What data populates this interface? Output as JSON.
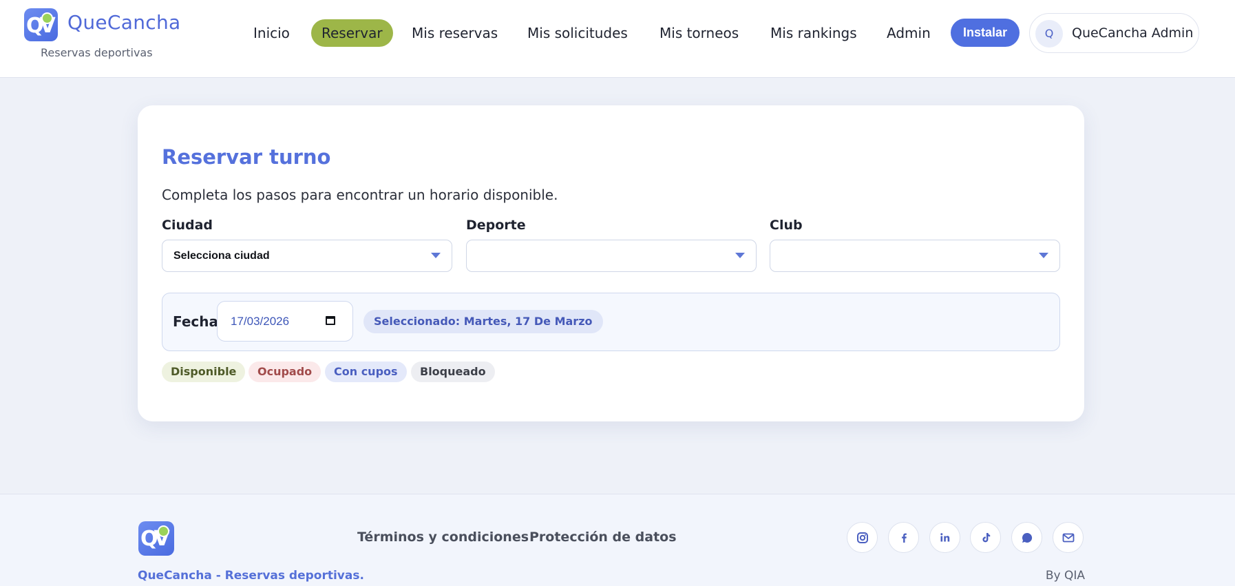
{
  "header": {
    "brand_name": "QueCancha",
    "brand_sub": "Reservas deportivas",
    "logo_glyph": "QV",
    "nav": [
      {
        "label": "Inicio",
        "active": false
      },
      {
        "label": "Reservar",
        "active": true
      },
      {
        "label": "Mis reservas",
        "active": false
      },
      {
        "label": "Mis solicitudes",
        "active": false
      },
      {
        "label": "Mis torneos",
        "active": false
      },
      {
        "label": "Mis rankings",
        "active": false
      },
      {
        "label": "Admin",
        "active": false
      }
    ],
    "install_label": "Instalar",
    "user": {
      "initial": "Q",
      "name": "QueCancha Admin"
    }
  },
  "main": {
    "title": "Reservar turno",
    "subtitle": "Completa los pasos para encontrar un horario disponible.",
    "fields": [
      {
        "label": "Ciudad",
        "value": "Selecciona ciudad"
      },
      {
        "label": "Deporte",
        "value": ""
      },
      {
        "label": "Club",
        "value": ""
      }
    ],
    "date": {
      "label": "Fecha",
      "value": "17/03/2026",
      "selected": "Seleccionado: Martes, 17 De Marzo"
    },
    "legend": [
      {
        "label": "Disponible",
        "status": "available"
      },
      {
        "label": "Ocupado",
        "status": "busy"
      },
      {
        "label": "Con cupos",
        "status": "spots"
      },
      {
        "label": "Bloqueado",
        "status": "blocked"
      }
    ]
  },
  "footer": {
    "links": [
      "Términos y condiciones",
      "Protección de datos"
    ],
    "social": [
      "instagram-icon",
      "facebook-icon",
      "linkedin-icon",
      "tiktok-icon",
      "whatsapp-icon",
      "mail-icon"
    ],
    "tagline": "QueCancha - Reservas deportivas.",
    "by": "By QIA"
  },
  "colors": {
    "primary": "#5069d8",
    "active_nav": "#9db648",
    "install": "#4f6fe0",
    "background": "#eef1f8"
  }
}
